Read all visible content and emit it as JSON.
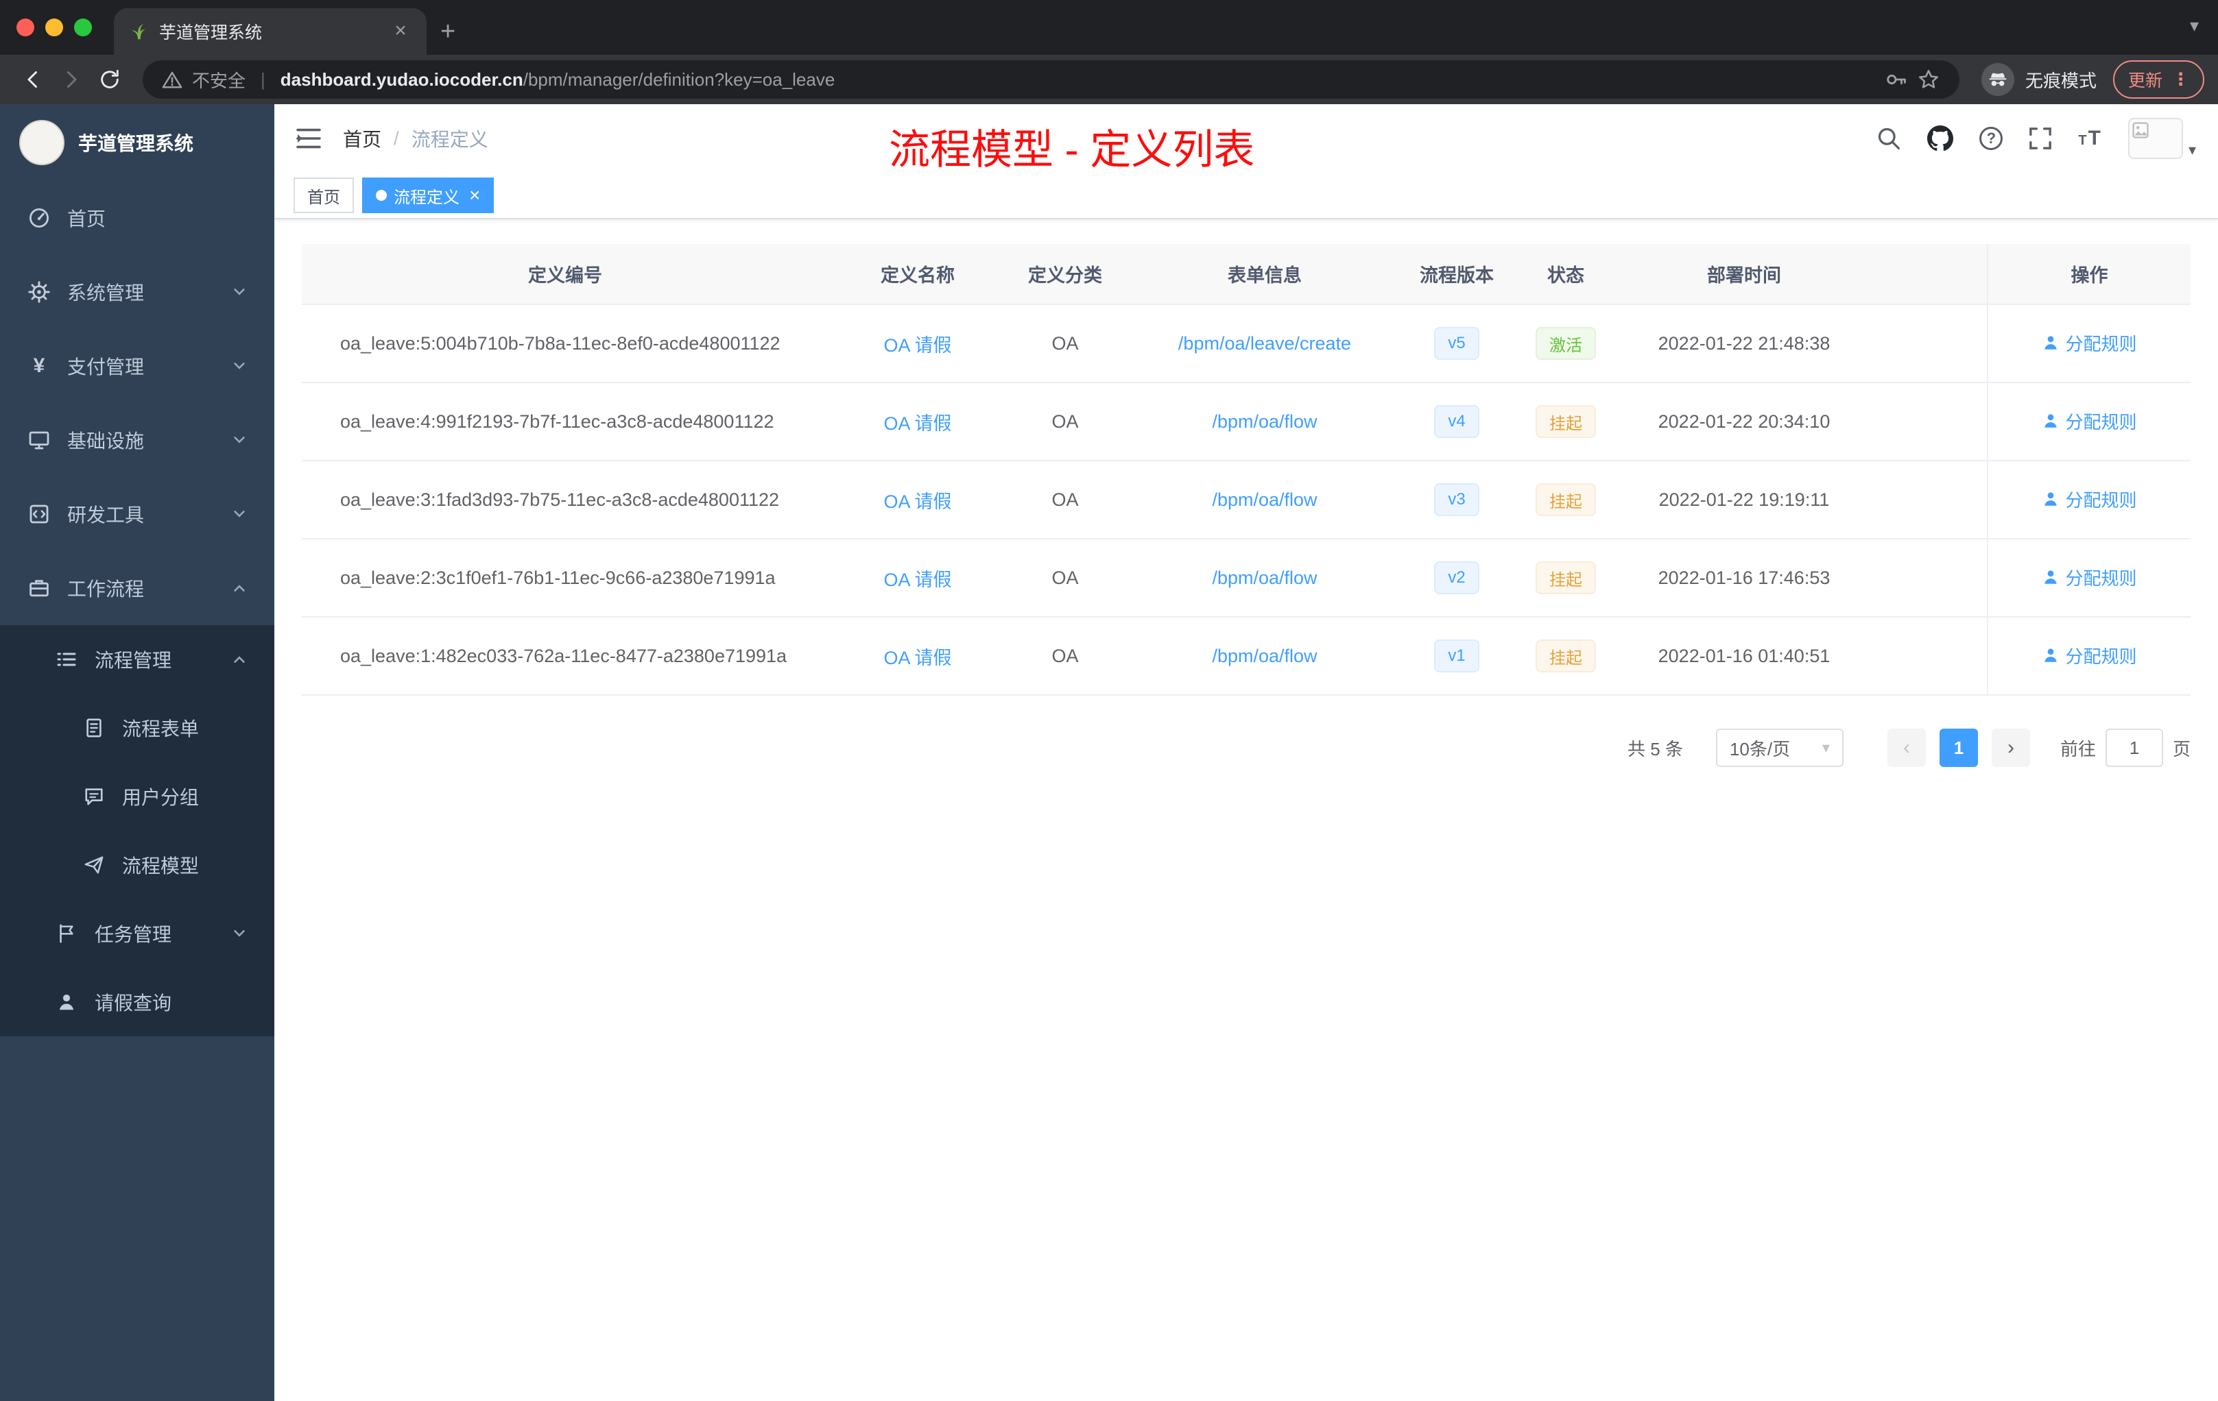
{
  "icons": {
    "close": "×",
    "plus": "+",
    "caret_down": "▾",
    "chevron_left": "‹",
    "chevron_right": "›",
    "kebab": "⋮",
    "url_divider": "|",
    "breadcrumb_separator": "/"
  },
  "colors": {
    "accent": "#409eff",
    "sidebar_bg": "#304156",
    "submenu_bg": "#1f2d3d",
    "success": "#67c23a",
    "warning": "#e6a23c",
    "annotation_red": "#fd0d0d",
    "update_red": "#f28b82"
  },
  "browser": {
    "tab": {
      "title": "芋道管理系统"
    },
    "address": {
      "security_text": "不安全",
      "url_host": "dashboard.yudao.iocoder.cn",
      "url_path": "/bpm/manager/definition?key=oa_leave"
    },
    "incognito_label": "无痕模式",
    "update_label": "更新"
  },
  "sidebar": {
    "logo_title": "芋道管理系统",
    "items": [
      {
        "label": "首页"
      },
      {
        "label": "系统管理"
      },
      {
        "label": "支付管理"
      },
      {
        "label": "基础设施"
      },
      {
        "label": "研发工具"
      },
      {
        "label": "工作流程"
      }
    ],
    "submenu": {
      "process_mgmt": {
        "label": "流程管理"
      },
      "children": [
        {
          "label": "流程表单"
        },
        {
          "label": "用户分组"
        },
        {
          "label": "流程模型"
        }
      ],
      "task_mgmt": {
        "label": "任务管理"
      },
      "leave_query": {
        "label": "请假查询"
      }
    }
  },
  "header": {
    "breadcrumb_home": "首页",
    "breadcrumb_current": "流程定义",
    "annotation": "流程模型 - 定义列表"
  },
  "tags": [
    {
      "label": "首页",
      "active": false
    },
    {
      "label": "流程定义",
      "active": true
    }
  ],
  "table": {
    "columns": [
      "定义编号",
      "定义名称",
      "定义分类",
      "表单信息",
      "流程版本",
      "状态",
      "部署时间",
      "操作"
    ],
    "action_label": "分配规则",
    "rows": [
      {
        "id": "oa_leave:5:004b710b-7b8a-11ec-8ef0-acde48001122",
        "name": "OA 请假",
        "category": "OA",
        "form": "/bpm/oa/leave/create",
        "version": "v5",
        "status": "激活",
        "status_type": "success",
        "time": "2022-01-22 21:48:38"
      },
      {
        "id": "oa_leave:4:991f2193-7b7f-11ec-a3c8-acde48001122",
        "name": "OA 请假",
        "category": "OA",
        "form": "/bpm/oa/flow",
        "version": "v4",
        "status": "挂起",
        "status_type": "warning",
        "time": "2022-01-22 20:34:10"
      },
      {
        "id": "oa_leave:3:1fad3d93-7b75-11ec-a3c8-acde48001122",
        "name": "OA 请假",
        "category": "OA",
        "form": "/bpm/oa/flow",
        "version": "v3",
        "status": "挂起",
        "status_type": "warning",
        "time": "2022-01-22 19:19:11"
      },
      {
        "id": "oa_leave:2:3c1f0ef1-76b1-11ec-9c66-a2380e71991a",
        "name": "OA 请假",
        "category": "OA",
        "form": "/bpm/oa/flow",
        "version": "v2",
        "status": "挂起",
        "status_type": "warning",
        "time": "2022-01-16 17:46:53"
      },
      {
        "id": "oa_leave:1:482ec033-762a-11ec-8477-a2380e71991a",
        "name": "OA 请假",
        "category": "OA",
        "form": "/bpm/oa/flow",
        "version": "v1",
        "status": "挂起",
        "status_type": "warning",
        "time": "2022-01-16 01:40:51"
      }
    ]
  },
  "pagination": {
    "total": "共 5 条",
    "page_size": "10条/页",
    "current": "1",
    "goto_prefix": "前往",
    "goto_value": "1",
    "goto_suffix": "页"
  }
}
